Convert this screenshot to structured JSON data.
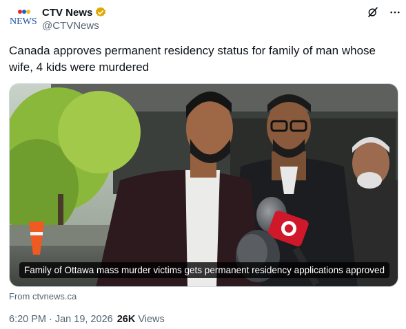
{
  "author": {
    "display_name": "CTV News",
    "handle": "@CTVNews",
    "logo_text": "NEWS",
    "avatar_icon": "ctv-news-logo",
    "verified_icon": "gold-verified-badge-icon",
    "verified_color": "#e0a800"
  },
  "header_actions": {
    "grok_icon": "grok-slash-icon",
    "more_icon": "more-dots-icon",
    "more_label": "···"
  },
  "tweet": {
    "text": "Canada approves permanent residency status for family of man whose wife, 4 kids were murdered"
  },
  "media": {
    "caption": "Family of Ottawa mass murder victims gets permanent residency applications approved",
    "microphone_logo_icon": "cbc-radio-canada-logo-icon",
    "accent_color": "#d0182b"
  },
  "source": {
    "text": "From ctvnews.ca"
  },
  "meta": {
    "time": "6:20 PM",
    "separator": "·",
    "date": "Jan 19, 2026",
    "views_count": "26K",
    "views_label": "Views"
  }
}
